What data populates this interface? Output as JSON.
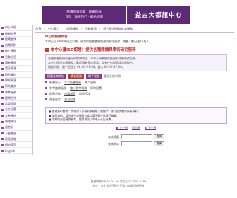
{
  "header": {
    "left_line1": "閱讀圖書館藏 · 圖書目錄",
    "left_line2": "首頁 · 聯絡我們 · 網站地圖",
    "title": "益古大都館中心"
  },
  "sidebar": {
    "items": [
      "中心介紹",
      "最新消息",
      "館藏查詢",
      "借閱規則",
      "線上服務",
      "活動訊息",
      "讀者專區",
      "電子資源",
      "期刊資料",
      "學術資源",
      "研究論文",
      "參考服務",
      "館際合作",
      "常見問題",
      "志工招募",
      "友善連結",
      "聯絡資訊",
      "留言板",
      "下載專區",
      "意見信箱",
      "網站導覽",
      "English"
    ]
  },
  "topnav": {
    "items": [
      "首頁",
      "中心簡介",
      "相關服務",
      "活動資訊"
    ],
    "search_link": "館內資源網路查詢服務"
  },
  "content": {
    "section_title": "中心的服務內容",
    "intro_line": "本中心自1998年成立以來，致力於推動書籍館藏與資訊服務，讀者人數已達10萬人。",
    "red_heading": "本中心獲ISO認證！提供各種閱讀與學術研究服務",
    "card_lines": [
      "為使讀者能夠有更好的閱讀環境，本中心持續擴充館藏及改善服務品質。",
      "本中心提供各項服務，歡迎讀者多加利用，如有任何問題請洽服務台。",
      "開放時間：週一至週五 08:00–21:00，週六 09:00–17:00。"
    ],
    "tags": [
      "館藏查詢系統",
      "讀者服務",
      "電子資源"
    ],
    "tag_note": "歡迎多加利用",
    "bullets": [
      {
        "text": "新書展示",
        "link": "本月新書推薦",
        "suffix": "每月更新"
      },
      {
        "text": "參考諮詢服務",
        "link": "線上參考服務",
        "suffix": "即時回覆"
      },
      {
        "text": "館際合作",
        "link": "申請說明",
        "suffix": "歡迎洽詢"
      },
      {
        "text": "讀者留言",
        "link": "意見回饋",
        "suffix": ""
      }
    ],
    "notice_lines": [
      "■ 館藏資料查詢：請利用下方檢索系統輸入關鍵字，即可查詢館內所有資料。",
      "■ 如需協助，請洽本中心服務台或以電子郵件與我們聯繫。",
      "■ 本網站內容僅供參考，實際資訊以本中心公告為準。"
    ],
    "links": [
      "▶ 上一頁",
      "回首頁",
      "▶ 下一頁"
    ]
  },
  "search": {
    "label1": "查詢館藏",
    "label2": "查詢網站",
    "placeholder": "",
    "button": "查詢"
  },
  "footer": {
    "line1": "服務時間 08:00–21:00  電話 (02)2345-6789",
    "line2": "地址：台北市中正區中正路100號  版權所有"
  }
}
